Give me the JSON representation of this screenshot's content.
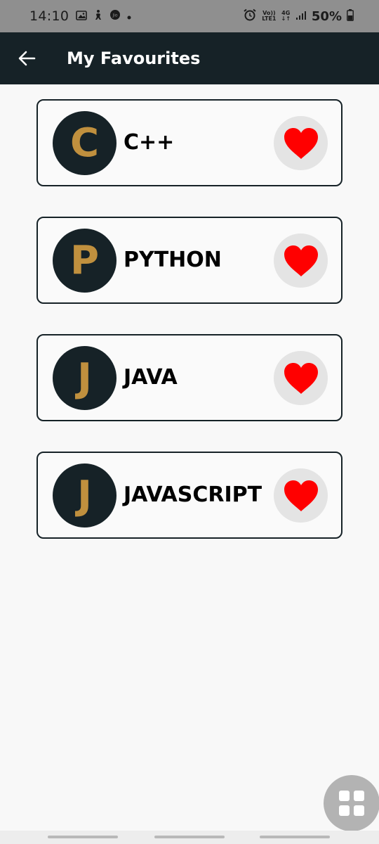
{
  "status_bar": {
    "time": "14:10",
    "carrier_top": "Vo))",
    "carrier_bottom": "LTE1",
    "network_top": "4G",
    "network_bottom": "↓↑",
    "battery_percent": "50%"
  },
  "app_bar": {
    "title": "My Favourites",
    "back_icon": "arrow-left-icon"
  },
  "favourites": [
    {
      "initial": "C",
      "name": "C++",
      "favourited": true
    },
    {
      "initial": "P",
      "name": "PYTHON",
      "favourited": true
    },
    {
      "initial": "J",
      "name": "JAVA",
      "favourited": true
    },
    {
      "initial": "J",
      "name": "JAVASCRIPT",
      "favourited": true
    }
  ],
  "fab": {
    "icon": "grid-icon"
  },
  "colors": {
    "app_bar_bg": "#162227",
    "avatar_bg": "#162227",
    "avatar_letter": "#c0903e",
    "heart": "#ff0000",
    "heart_button_bg": "#e4e4e4",
    "status_bar_bg": "#8f8f8f"
  }
}
